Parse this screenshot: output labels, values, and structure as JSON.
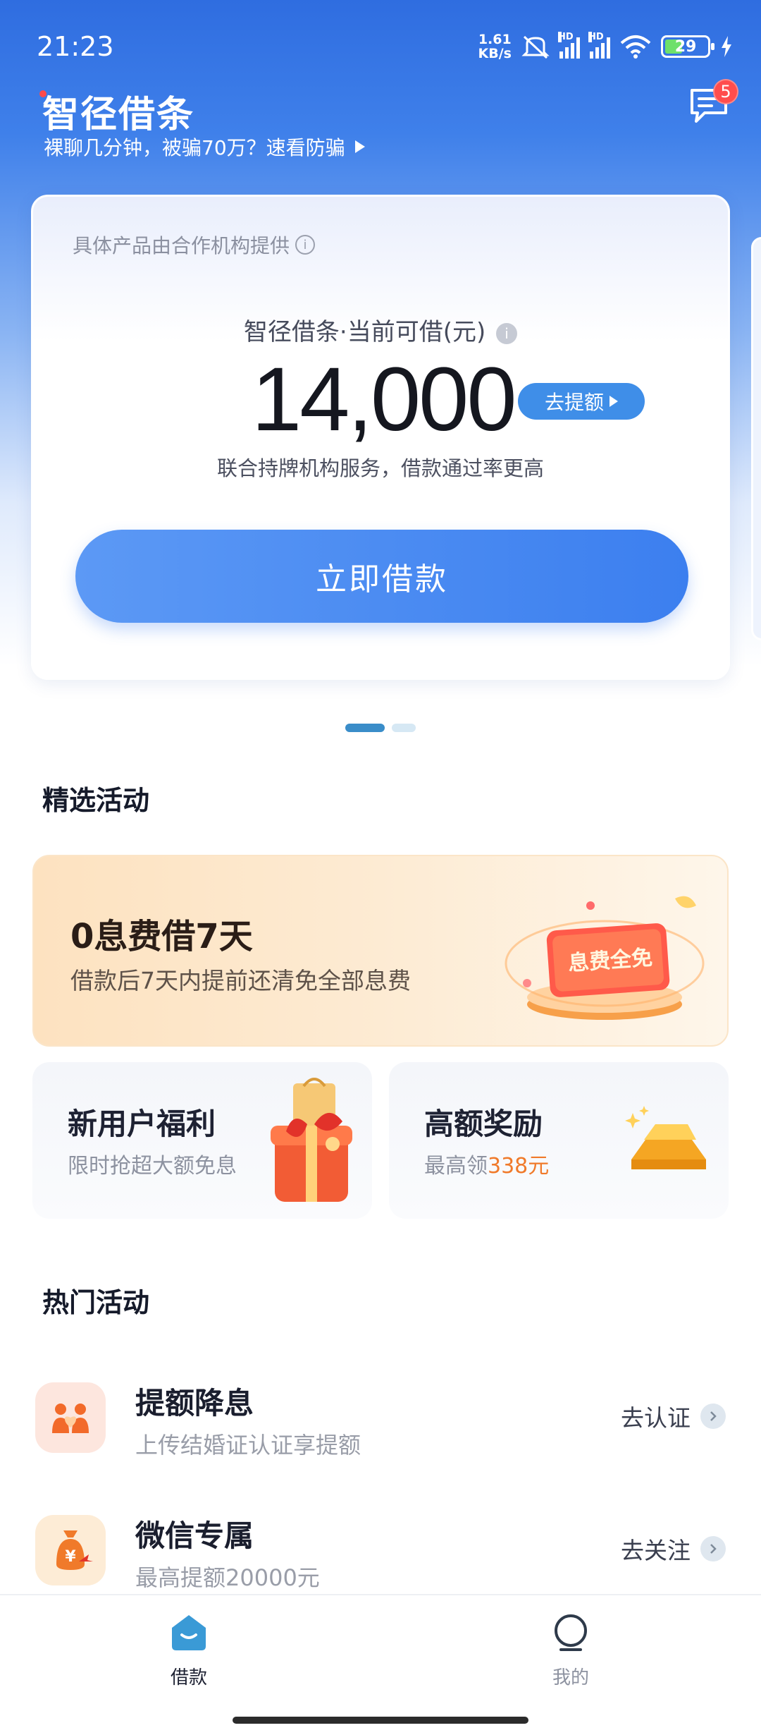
{
  "status_bar": {
    "time": "21:23",
    "net_speed_value": "1.61",
    "net_speed_unit": "KB/s",
    "hd1": "HD",
    "hd2": "HD",
    "battery": "29"
  },
  "header": {
    "title": "智径借条",
    "notice": "裸聊几分钟，被骗70万？速看防骗",
    "message_badge": "5"
  },
  "loan_card": {
    "provider_text": "具体产品由合作机构提供",
    "info_glyph": "i",
    "credit_label": "智径借条·当前可借(元)",
    "amount": "14,000",
    "raise_button": "去提额",
    "subline": "联合持牌机构服务，借款通过率更高",
    "borrow_button": "立即借款"
  },
  "featured": {
    "title": "精选活动",
    "big_promo": {
      "title": "0息费借7天",
      "subtitle": "借款后7天内提前还清免全部息费",
      "badge_text": "息费全免"
    },
    "new_user": {
      "title": "新用户福利",
      "subtitle": "限时抢超大额免息"
    },
    "high_reward": {
      "title": "高额奖励",
      "subtitle_prefix": "最高领",
      "subtitle_highlight": "338元"
    }
  },
  "hot": {
    "title": "热门活动",
    "items": [
      {
        "title": "提额降息",
        "subtitle": "上传结婚证认证享提额",
        "action": "去认证"
      },
      {
        "title": "微信专属",
        "subtitle": "最高提额20000元",
        "action": "去关注"
      }
    ]
  },
  "tabbar": {
    "tabs": [
      {
        "label": "借款",
        "active": true
      },
      {
        "label": "我的",
        "active": false
      }
    ]
  },
  "colors": {
    "accent": "#3c7fef",
    "tab_active": "#3a8dc9",
    "badge": "#ff4d4d",
    "highlight": "#f07a2a"
  }
}
